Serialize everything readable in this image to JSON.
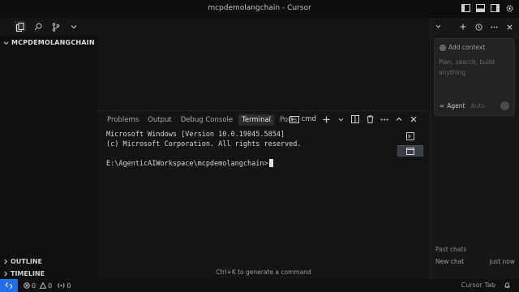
{
  "window": {
    "title": "mcpdemolangchain - Cursor"
  },
  "explorer": {
    "project": "MCPDEMOLANGCHAIN",
    "outline": "OUTLINE",
    "timeline": "TIMELINE"
  },
  "panel": {
    "tabs": [
      {
        "label": "Problems"
      },
      {
        "label": "Output"
      },
      {
        "label": "Debug Console"
      },
      {
        "label": "Terminal",
        "active": true
      },
      {
        "label": "Ports"
      }
    ],
    "shell": "cmd",
    "terminal_lines": [
      "Microsoft Windows [Version 10.0.19045.5854]",
      "(c) Microsoft Corporation. All rights reserved.",
      "",
      "E:\\AgenticAIWorkspace\\mcpdemolangchain>"
    ],
    "hint": "Ctrl+K to generate a command"
  },
  "chat": {
    "add_context": "Add context",
    "placeholder": "Plan, search, build anything",
    "mode": "Agent",
    "model": "Auto",
    "past_chats_label": "Past chats",
    "past_chats": [
      {
        "title": "New chat",
        "time": "just now"
      }
    ]
  },
  "status": {
    "errors": "0",
    "warnings": "0",
    "ports": "0",
    "right_label": "Cursor Tab"
  },
  "colors": {
    "remote": "#1f6feb",
    "background": "#141414"
  }
}
